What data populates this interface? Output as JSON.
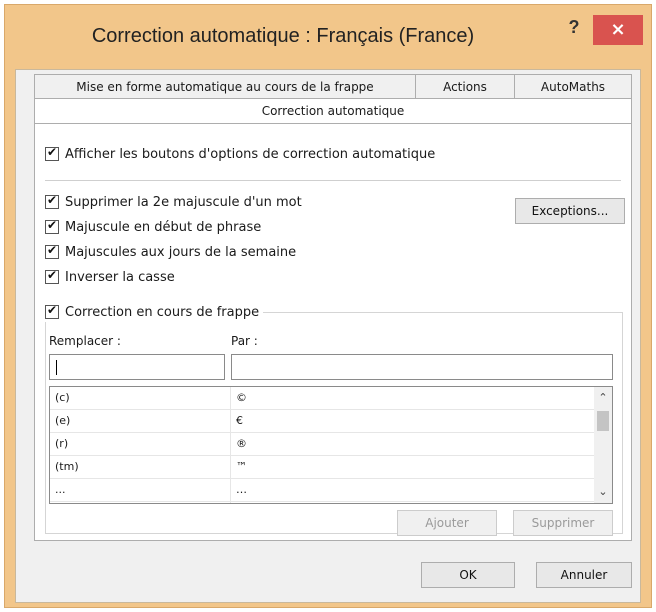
{
  "dialog": {
    "title": "Correction automatique : Français (France)",
    "help_label": "?",
    "close_label": "×"
  },
  "tabs": {
    "row1": [
      "Mise en forme automatique au cours de la frappe",
      "Actions",
      "AutoMaths"
    ],
    "selected": "Correction automatique"
  },
  "options": {
    "show_buttons": {
      "label": "Afficher les boutons d'options de correction automatique",
      "checked": true
    },
    "two_caps": {
      "label": "Supprimer la 2e majuscule d'un mot",
      "checked": true
    },
    "sentence_cap": {
      "label": "Majuscule en début de phrase",
      "checked": true
    },
    "day_names": {
      "label": "Majuscules aux jours de la semaine",
      "checked": true
    },
    "caps_lock": {
      "label": "Inverser la casse",
      "checked": true
    },
    "replace_typing": {
      "label": "Correction en cours de frappe",
      "checked": true
    }
  },
  "buttons": {
    "exceptions": "Exceptions...",
    "add": "Ajouter",
    "delete": "Supprimer",
    "ok": "OK",
    "cancel": "Annuler"
  },
  "replace": {
    "replace_label": "Remplacer :",
    "with_label": "Par :",
    "replace_value": "",
    "with_value": ""
  },
  "list": {
    "rows": [
      {
        "from": "(c)",
        "to": "©"
      },
      {
        "from": "(e)",
        "to": "€"
      },
      {
        "from": "(r)",
        "to": "®"
      },
      {
        "from": "(tm)",
        "to": "™"
      },
      {
        "from": "...",
        "to": "…"
      }
    ]
  },
  "scroll": {
    "up_icon": "chevron-up-icon",
    "down_icon": "chevron-down-icon"
  }
}
